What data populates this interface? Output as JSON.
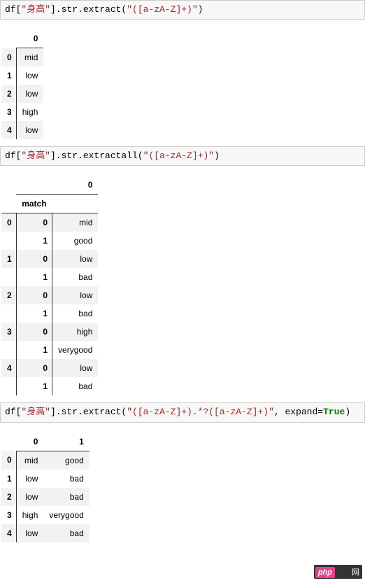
{
  "cell1": {
    "prefix": "df[",
    "col_str": "\"身高\"",
    "mid1": "].str.extract(",
    "regex_str": "\"([a-zA-Z]+)\"",
    "suffix": ")"
  },
  "table1": {
    "col": "0",
    "rows": [
      {
        "idx": "0",
        "v": "mid"
      },
      {
        "idx": "1",
        "v": "low"
      },
      {
        "idx": "2",
        "v": "low"
      },
      {
        "idx": "3",
        "v": "high"
      },
      {
        "idx": "4",
        "v": "low"
      }
    ]
  },
  "cell2": {
    "prefix": "df[",
    "col_str": "\"身高\"",
    "mid1": "].str.extractall(",
    "regex_str": "\"([a-zA-Z]+)\"",
    "suffix": ")"
  },
  "table2": {
    "col": "0",
    "index_name": "match",
    "rows": [
      {
        "idx0": "0",
        "idx1": "0",
        "v": "mid"
      },
      {
        "idx0": "",
        "idx1": "1",
        "v": "good"
      },
      {
        "idx0": "1",
        "idx1": "0",
        "v": "low"
      },
      {
        "idx0": "",
        "idx1": "1",
        "v": "bad"
      },
      {
        "idx0": "2",
        "idx1": "0",
        "v": "low"
      },
      {
        "idx0": "",
        "idx1": "1",
        "v": "bad"
      },
      {
        "idx0": "3",
        "idx1": "0",
        "v": "high"
      },
      {
        "idx0": "",
        "idx1": "1",
        "v": "verygood"
      },
      {
        "idx0": "4",
        "idx1": "0",
        "v": "low"
      },
      {
        "idx0": "",
        "idx1": "1",
        "v": "bad"
      }
    ]
  },
  "cell3": {
    "prefix": "df[",
    "col_str": "\"身高\"",
    "mid1": "].str.extract(",
    "regex_str": "\"([a-zA-Z]+).*?([a-zA-Z]+)\"",
    "mid2": ", expand=",
    "kw": "True",
    "suffix": ")"
  },
  "table3": {
    "col0": "0",
    "col1": "1",
    "rows": [
      {
        "idx": "0",
        "v0": "mid",
        "v1": "good"
      },
      {
        "idx": "1",
        "v0": "low",
        "v1": "bad"
      },
      {
        "idx": "2",
        "v0": "low",
        "v1": "bad"
      },
      {
        "idx": "3",
        "v0": "high",
        "v1": "verygood"
      },
      {
        "idx": "4",
        "v0": "low",
        "v1": "bad"
      }
    ]
  },
  "badge": {
    "php": "php",
    "rest": "　　网"
  }
}
